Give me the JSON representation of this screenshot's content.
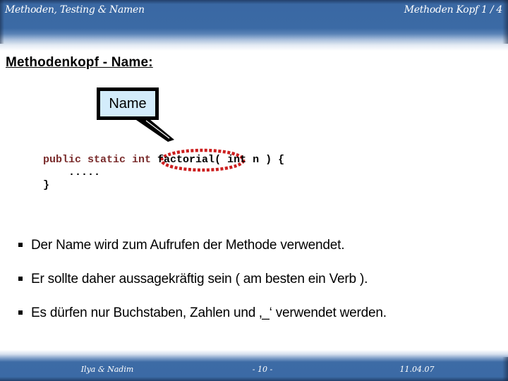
{
  "header": {
    "left_title": "Methoden, Testing & Namen",
    "right_title": "Methoden Kopf 1 / 4"
  },
  "slide": {
    "title": "Methodenkopf - Name:",
    "callout": {
      "label": "Name",
      "fill_color": "#d3ecfb",
      "highlight_color": "#cc1f1f"
    },
    "code": {
      "keywords": "public static int",
      "method_name": "factorial",
      "params": "( int n ) {",
      "body": "    .....",
      "closing": "}"
    },
    "bullets": [
      "Der Name wird zum Aufrufen der Methode verwendet.",
      "Er sollte daher aussagekräftig sein ( am besten ein Verb ).",
      "Es dürfen nur Buchstaben, Zahlen und ‚_‘  verwendet werden."
    ]
  },
  "footer": {
    "authors": "Ilya & Nadim",
    "page": "- 10 -",
    "date": "11.04.07"
  },
  "colors": {
    "header_blue": "#3b6aa5",
    "keyword_color": "#7a2c2c"
  }
}
